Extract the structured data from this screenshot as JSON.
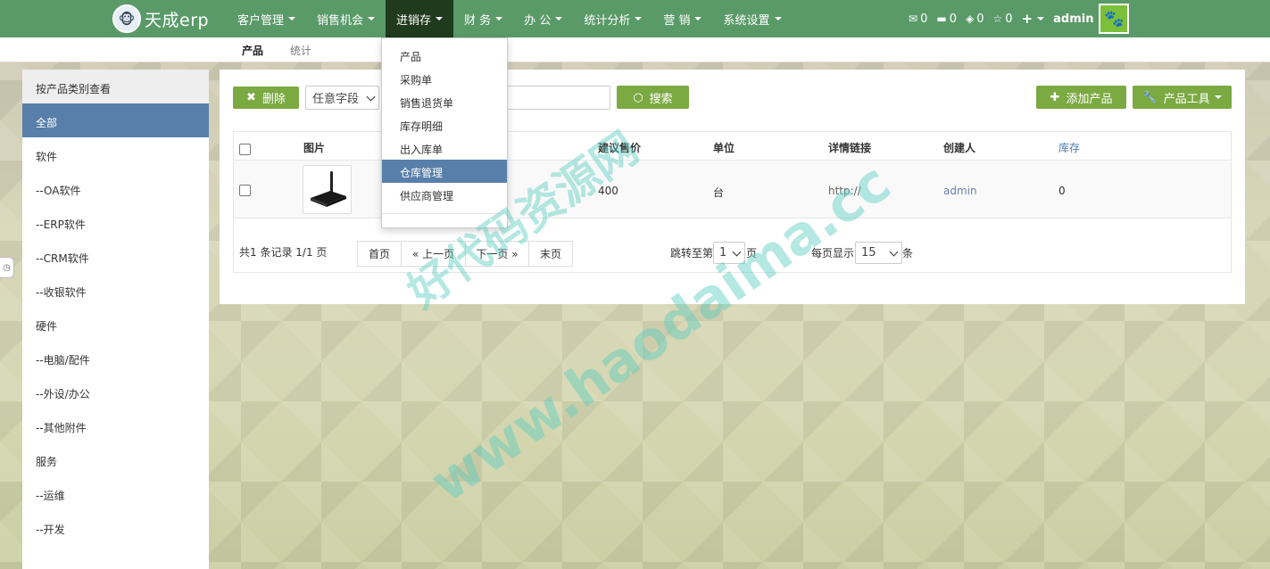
{
  "app": {
    "logo_text": "天成erp",
    "logo_glyph": "🐵"
  },
  "topnav": {
    "menu": [
      {
        "label": "客户管理"
      },
      {
        "label": "销售机会"
      },
      {
        "label": "进销存"
      },
      {
        "label": "财 务"
      },
      {
        "label": "办 公"
      },
      {
        "label": "统计分析"
      },
      {
        "label": "营 销"
      },
      {
        "label": "系统设置"
      }
    ],
    "counters": {
      "mail": "0",
      "tasks": "0",
      "diamond": "0",
      "star": "0"
    },
    "user": "admin",
    "plus": "+"
  },
  "subnav": {
    "tabs": [
      {
        "label": "产品"
      },
      {
        "label": "统计"
      }
    ]
  },
  "sidebar": {
    "title": "按产品类别查看",
    "items": [
      {
        "label": "全部"
      },
      {
        "label": "软件"
      },
      {
        "label": "--OA软件"
      },
      {
        "label": "--ERP软件"
      },
      {
        "label": "--CRM软件"
      },
      {
        "label": "--收银软件"
      },
      {
        "label": "硬件"
      },
      {
        "label": "--电脑/配件"
      },
      {
        "label": "--外设/办公"
      },
      {
        "label": "--其他附件"
      },
      {
        "label": "服务"
      },
      {
        "label": "--运维"
      },
      {
        "label": "--开发"
      }
    ]
  },
  "toolbar": {
    "delete_label": "删除",
    "field_select": "任意字段",
    "search_label": "搜索",
    "add_label": "添加产品",
    "tools_label": "产品工具"
  },
  "table": {
    "headers": {
      "image": "图片",
      "price": "建议售价",
      "unit": "单位",
      "link": "详情链接",
      "creator": "创建人",
      "stock": "库存"
    },
    "rows": [
      {
        "price": "400",
        "unit": "台",
        "link": "http://",
        "creator": "admin",
        "stock": "0"
      }
    ]
  },
  "pagination": {
    "info": "共1 条记录 1/1 页",
    "buttons": [
      {
        "label": "首页"
      },
      {
        "label": "« 上一页"
      },
      {
        "label": "下一页 »"
      },
      {
        "label": "末页"
      }
    ],
    "jump_prefix": "跳转至第",
    "jump_value": "1",
    "jump_suffix": "页",
    "per_page_prefix": "每页显示",
    "per_page_value": "15",
    "per_page_suffix": "条"
  },
  "dropdown": {
    "items": [
      {
        "label": "产品"
      },
      {
        "label": "采购单"
      },
      {
        "label": "销售退货单"
      },
      {
        "label": "库存明细"
      },
      {
        "label": "出入库单"
      },
      {
        "label": "仓库管理"
      },
      {
        "label": "供应商管理"
      }
    ]
  },
  "watermark": {
    "line1": "好代码资源网",
    "line2": "www.haodaima.cc"
  },
  "colors": {
    "nav_green": "#5a9a68",
    "active_menu": "#1f3a1c",
    "button_green": "#7ba942",
    "selected_blue": "#587fa9"
  }
}
